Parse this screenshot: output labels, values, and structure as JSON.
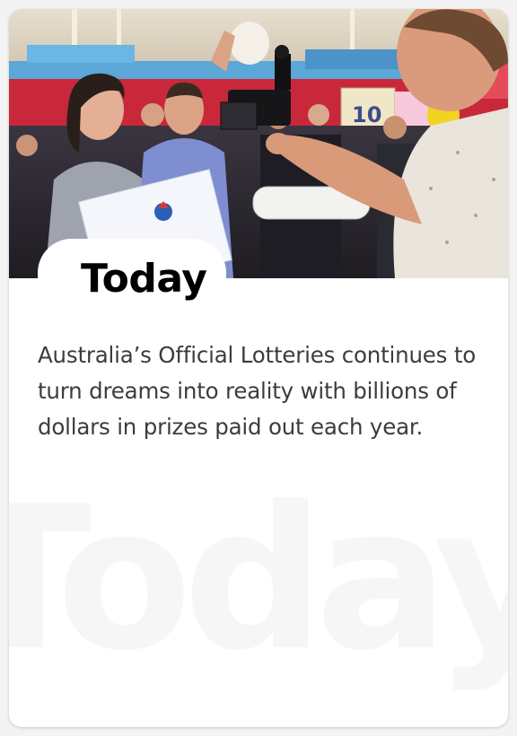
{
  "card": {
    "heading": "Today",
    "body": "Australia’s Official Lotteries continues to turn dreams into reality with billions of dollars in prizes paid out each year.",
    "watermark": "Today"
  },
  "photo": {
    "subject": "celebrating-winners-photo",
    "colors": {
      "ceiling": "#d9d0c0",
      "wall_red": "#c8283a",
      "sky_blue": "#5aa7d8",
      "crowd_dark": "#2b2a30",
      "balloon_yellow": "#f3d321"
    }
  }
}
